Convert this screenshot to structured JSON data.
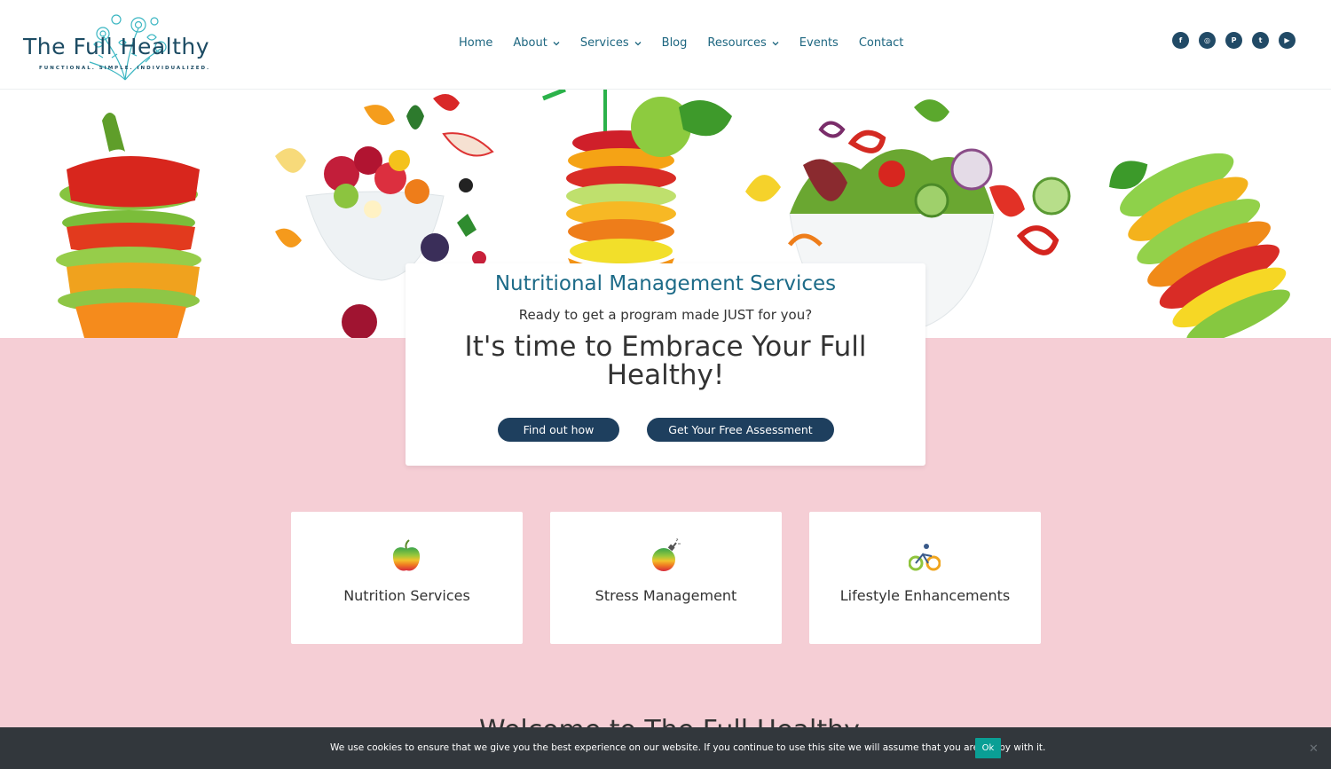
{
  "brand": {
    "name": "The Full Healthy",
    "tagline": "FUNCTIONAL. SIMPLE. INDIVIDUALIZED."
  },
  "nav": {
    "items": [
      {
        "label": "Home",
        "dropdown": false
      },
      {
        "label": "About",
        "dropdown": true
      },
      {
        "label": "Services",
        "dropdown": true
      },
      {
        "label": "Blog",
        "dropdown": false
      },
      {
        "label": "Resources",
        "dropdown": true
      },
      {
        "label": "Events",
        "dropdown": false
      },
      {
        "label": "Contact",
        "dropdown": false
      }
    ]
  },
  "social": {
    "icons": [
      "facebook-icon",
      "instagram-icon",
      "pinterest-icon",
      "twitter-icon",
      "youtube-icon"
    ],
    "glyphs": [
      "f",
      "◎",
      "P",
      "t",
      "▶"
    ]
  },
  "hero_card": {
    "kicker": "Nutritional Management Services",
    "sub": "Ready to get a program made JUST for you?",
    "headline": "It's time to Embrace Your Full Healthy!",
    "button_primary": "Find out how",
    "button_secondary": "Get Your Free Assessment"
  },
  "services": [
    {
      "label": "Nutrition Services",
      "icon": "apple-icon"
    },
    {
      "label": "Stress Management",
      "icon": "bomb-icon"
    },
    {
      "label": "Lifestyle Enhancements",
      "icon": "bicycle-icon"
    }
  ],
  "welcome": {
    "partial_heading": "Welcome to The Full Healthy"
  },
  "cookie": {
    "text": "We use cookies to ensure that we give you the best experience on our website. If you continue to use this site we will assume that you are happy with it.",
    "ok_label": "Ok",
    "close_glyph": "✕"
  },
  "colors": {
    "brand_dark": "#1c4b63",
    "nav_link": "#1d6680",
    "button": "#1e3f5e",
    "pink_bg": "#f5ced5",
    "cookie_bg": "#32373c",
    "cookie_ok": "#0a9f95"
  }
}
